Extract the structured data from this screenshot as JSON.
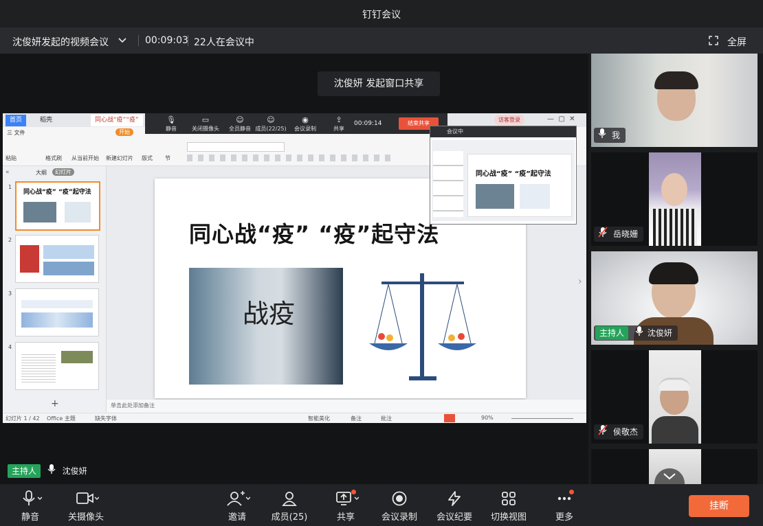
{
  "app": {
    "title": "钉钉会议"
  },
  "meeting": {
    "title": "沈俊妍发起的视频会议",
    "elapsed": "00:09:03",
    "participants_text": "22人在会议中",
    "fullscreen_label": "全屏",
    "share_tip": "沈俊妍 发起窗口共享",
    "host_badge": "主持人",
    "presenter_name": "沈俊妍"
  },
  "shared_window": {
    "tabs": [
      "首页",
      "稻壳",
      "同心战“疫”“疫”"
    ],
    "menu": [
      "三 文件",
      "开始"
    ],
    "ribbon": [
      "粘贴",
      "格式刷",
      "从当前开始",
      "新建幻灯片",
      "版式",
      "节"
    ],
    "floating_toolbar": {
      "items": [
        "静音",
        "关闭摄像头",
        "全员静音",
        "成员(22/25)",
        "会议录制",
        "共享"
      ],
      "timer": "00:09:14",
      "end_share": "结束共享"
    },
    "outline_tabs": [
      "大纲",
      "幻灯片"
    ],
    "slide_title": "同心战“疫”  “疫”起守法",
    "slide_image_text": "战疫",
    "notes_placeholder": "单击此处添加备注",
    "status": {
      "slide_counter": "幻灯片 1 / 42",
      "theme": "Office 主题",
      "font_warning": "缺失字体",
      "smart": "智能美化",
      "notes": "备注",
      "comment": "批注",
      "zoom": "90%"
    },
    "mini_window_title": "会议中",
    "mini_slide_title": "同心战“疫”  “疫”起守法",
    "guest_login": "访客登录"
  },
  "participants": [
    {
      "name": "我",
      "muted": false,
      "host": false
    },
    {
      "name": "岳晓姗",
      "muted": true,
      "host": false
    },
    {
      "name": "沈俊妍",
      "muted": false,
      "host": true
    },
    {
      "name": "侯敬杰",
      "muted": true,
      "host": false
    }
  ],
  "toolbar": {
    "items": [
      {
        "label": "静音",
        "icon": "microphone-icon"
      },
      {
        "label": "关摄像头",
        "icon": "camera-icon"
      },
      {
        "label": "邀请",
        "icon": "add-user-icon"
      },
      {
        "label": "成员(25)",
        "icon": "members-icon"
      },
      {
        "label": "共享",
        "icon": "share-screen-icon"
      },
      {
        "label": "会议录制",
        "icon": "record-icon"
      },
      {
        "label": "会议纪要",
        "icon": "minutes-icon"
      },
      {
        "label": "切换视图",
        "icon": "grid-view-icon"
      },
      {
        "label": "更多",
        "icon": "more-icon"
      }
    ],
    "hangup_label": "挂断"
  },
  "colors": {
    "accent_green": "#25a35a",
    "hangup": "#f26a3a",
    "end_share_red": "#e8523a",
    "notify_dot": "#f2563a"
  }
}
